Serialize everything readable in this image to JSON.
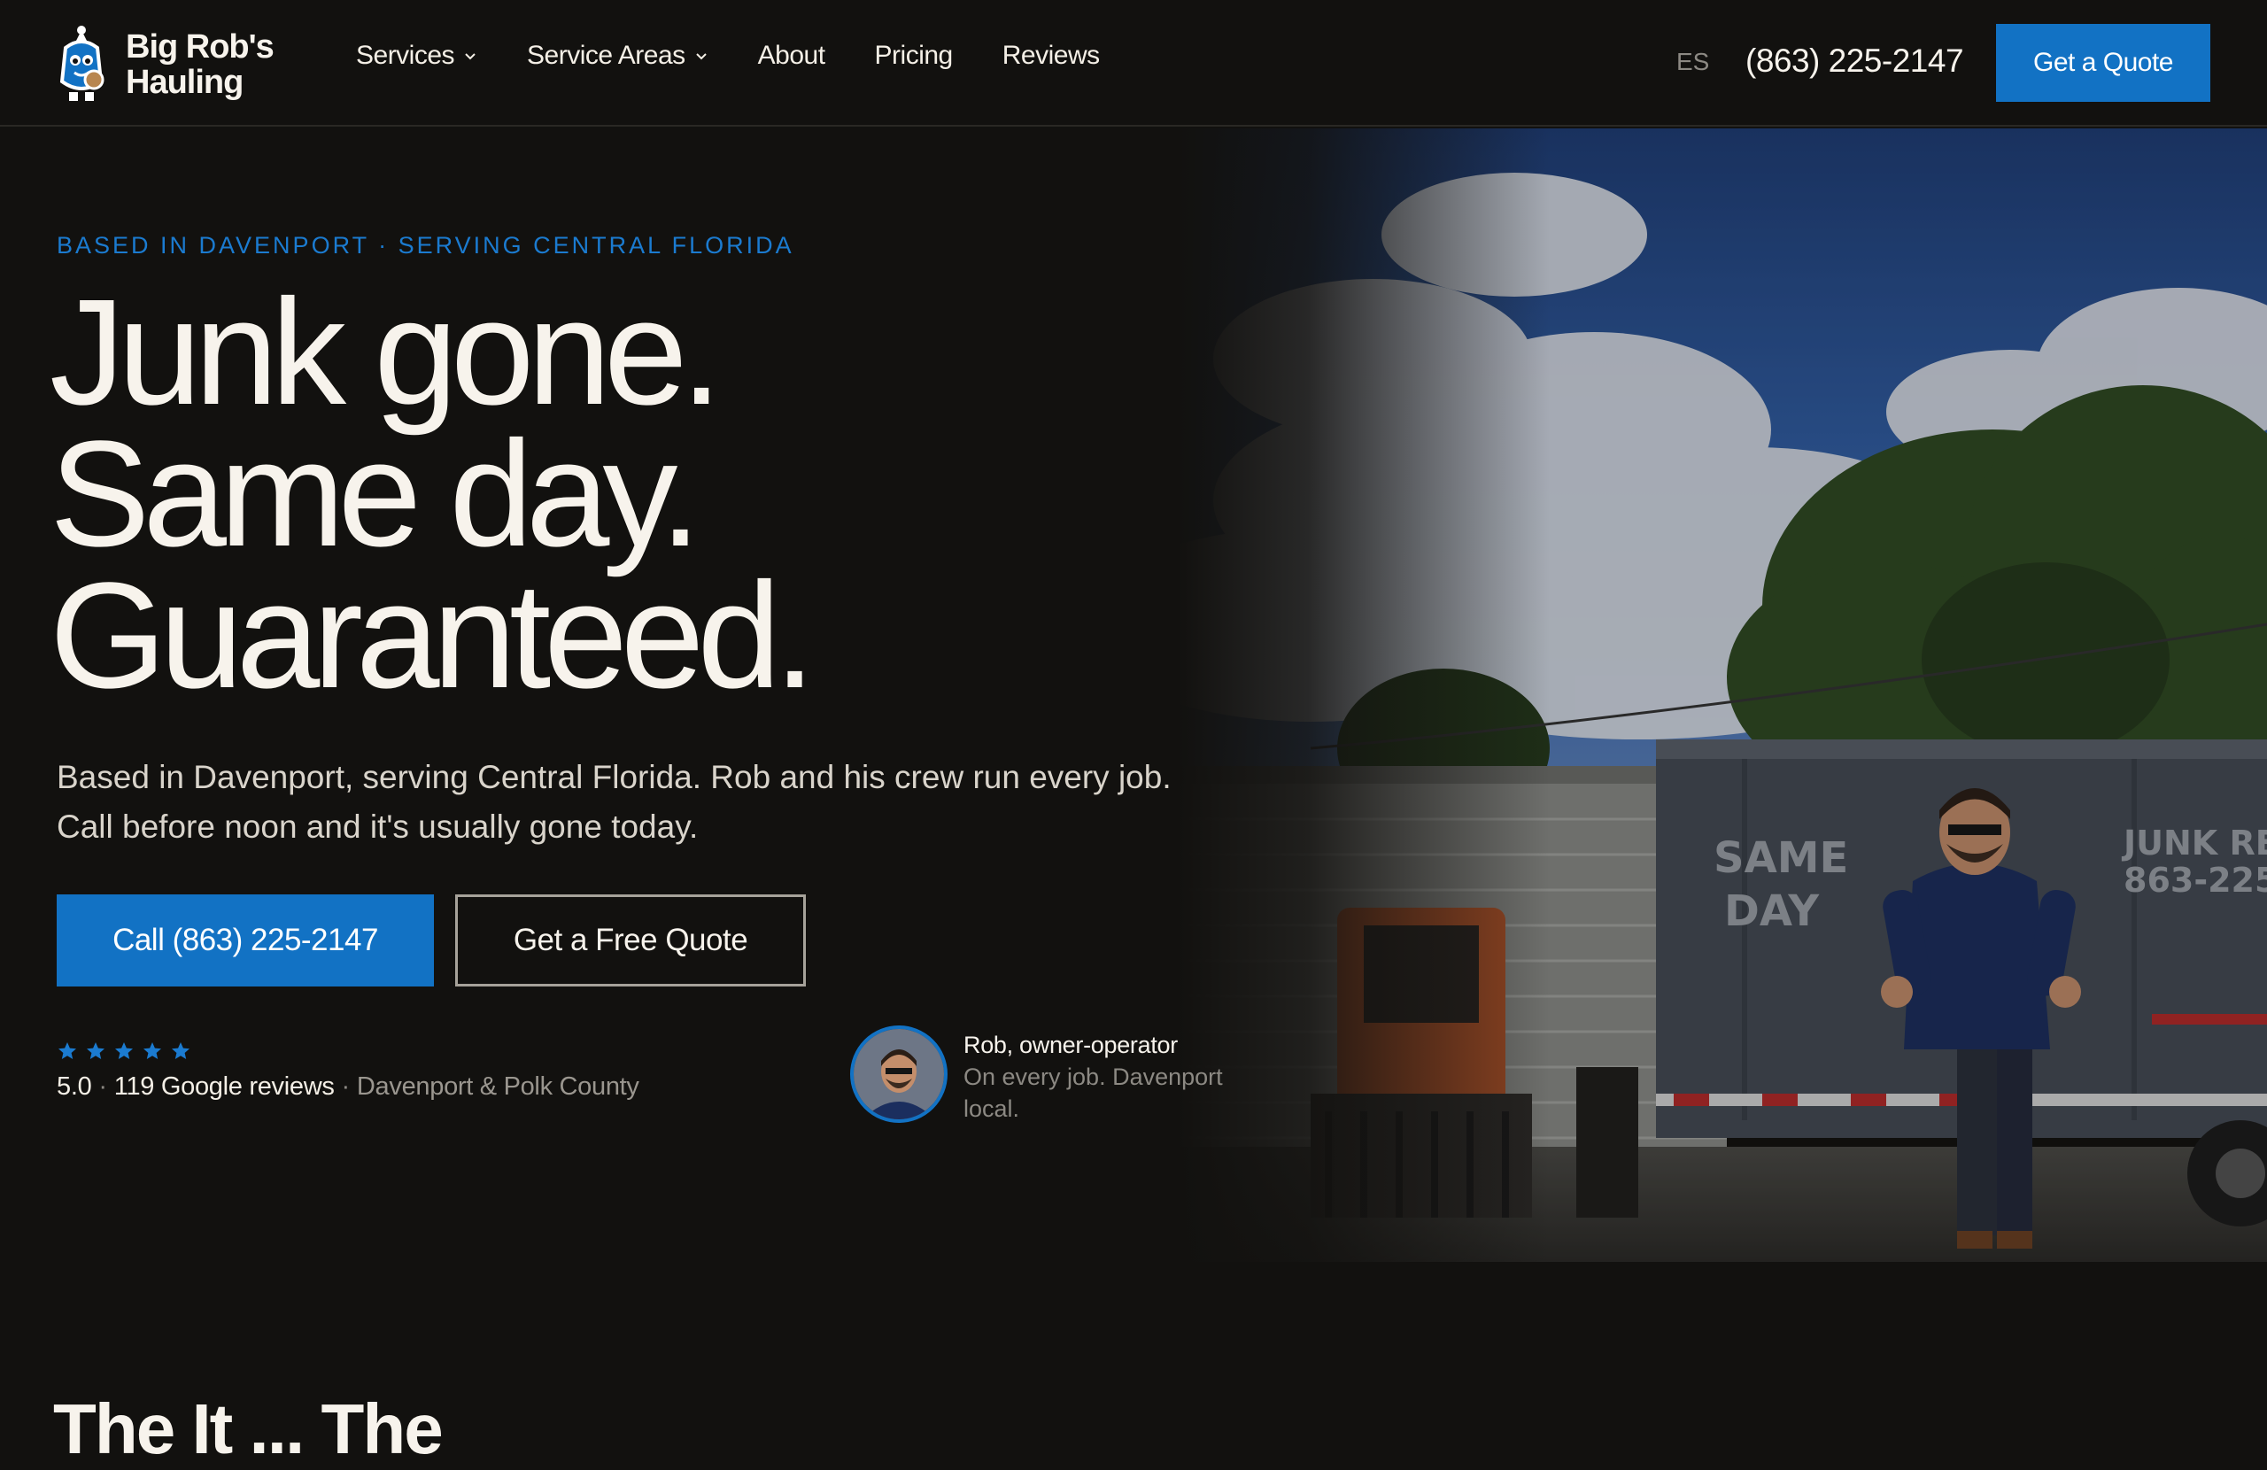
{
  "brand": {
    "name_line1": "Big Rob's",
    "name_line2": "Hauling",
    "logo_icon": "mascot-logo-icon"
  },
  "nav": {
    "items": [
      {
        "label": "Services",
        "has_dropdown": true
      },
      {
        "label": "Service Areas",
        "has_dropdown": true
      },
      {
        "label": "About",
        "has_dropdown": false
      },
      {
        "label": "Pricing",
        "has_dropdown": false
      },
      {
        "label": "Reviews",
        "has_dropdown": false
      }
    ],
    "lang_label": "ES",
    "phone": "(863) 225-2147",
    "quote_label": "Get a Quote"
  },
  "hero": {
    "eyebrow": "BASED IN DAVENPORT · SERVING CENTRAL FLORIDA",
    "headline": [
      "Junk gone.",
      "Same day.",
      "Guaranteed."
    ],
    "sub_lines": [
      "Based in Davenport, serving Central Florida. Rob and his crew run every job.",
      "Call before noon and it's usually gone today."
    ],
    "call_label": "Call (863) 225-2147",
    "free_quote_label": "Get a Free Quote",
    "rating": {
      "stars": 5,
      "score": "5.0",
      "reviews": "119 Google reviews",
      "area": "Davenport & Polk County"
    },
    "owner": {
      "name": "Rob, owner-operator",
      "desc": "On every job. Davenport local."
    },
    "photo": {
      "dumpster_text_left_1": "SAME",
      "dumpster_text_left_2": "DAY",
      "dumpster_text_right_1": "JUNK REM",
      "dumpster_text_right_2": "863-225"
    }
  },
  "next_section": {
    "title_peek": "The                         It     ...   The"
  },
  "colors": {
    "background": "#12110f",
    "accent_blue": "#1272c4",
    "text_light": "#f7f3ec",
    "muted": "#8c8983"
  }
}
